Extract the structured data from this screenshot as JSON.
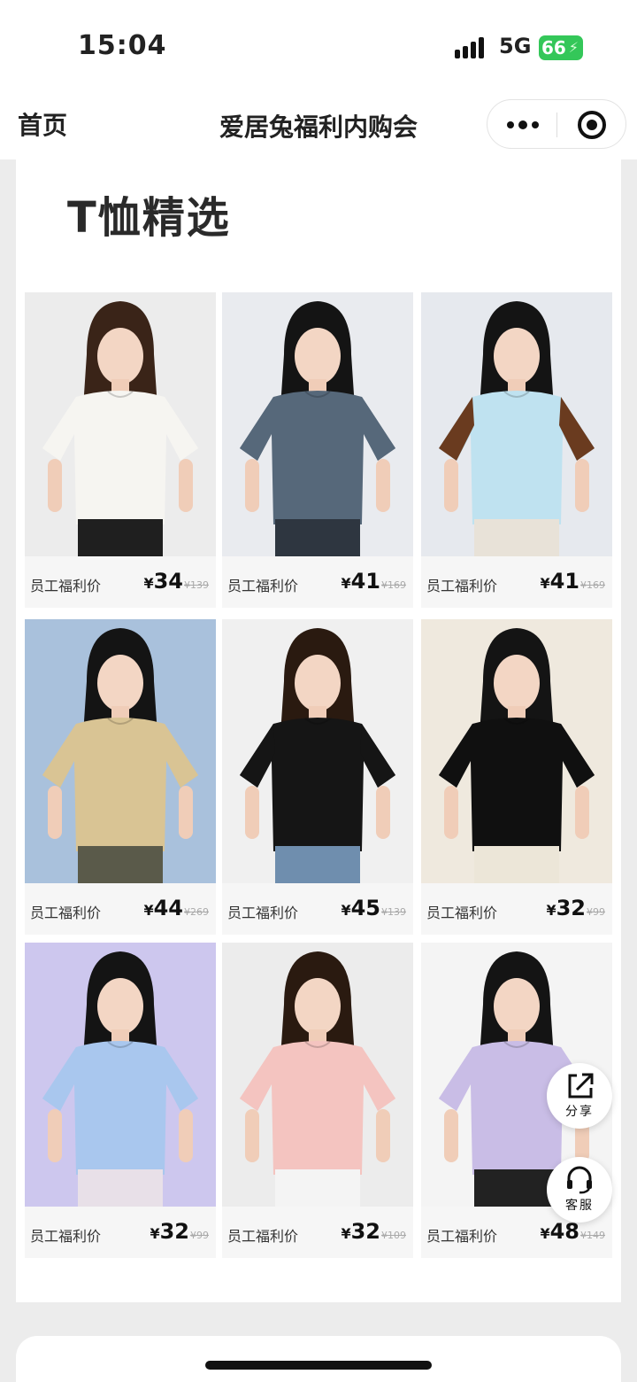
{
  "status_bar": {
    "time": "15:04",
    "network": "5G",
    "battery": "66"
  },
  "nav": {
    "home_label": "首页",
    "title": "爱居兔福利内购会"
  },
  "section": {
    "title": "T恤精选"
  },
  "price_label": "员工福利价",
  "currency": "¥",
  "products": [
    {
      "price": "34",
      "original": "139",
      "shirt": "#f6f5f1",
      "bg": "#ececec",
      "hair": "#3a2418",
      "pants": "#1f1f1f",
      "shirt_icon": "white-asymmetric-shirt-icon"
    },
    {
      "price": "41",
      "original": "169",
      "shirt": "#56687a",
      "bg": "#e9ebef",
      "hair": "#141414",
      "pants": "#2e3640",
      "shirt_icon": "denim-tee-icon"
    },
    {
      "price": "41",
      "original": "169",
      "shirt": "#bfe2f0",
      "bg": "#e6e9ee",
      "hair": "#141414",
      "pants": "#e8e2d8",
      "sleeve": "#6a3b1f",
      "shirt_icon": "raglan-tee-icon"
    },
    {
      "price": "44",
      "original": "269",
      "shirt": "#d9c494",
      "bg": "#a9c1dc",
      "hair": "#141414",
      "pants": "#5a5a4a",
      "shirt_icon": "graphic-tee-icon"
    },
    {
      "price": "45",
      "original": "139",
      "shirt": "#151515",
      "bg": "#f0f0f0",
      "hair": "#2a1a10",
      "pants": "#6f8eae",
      "shirt_icon": "black-tee-icon"
    },
    {
      "price": "32",
      "original": "99",
      "shirt": "#101010",
      "bg": "#efe9de",
      "hair": "#141414",
      "pants": "#ece6d8",
      "shirt_icon": "black-tee-scarf-icon"
    },
    {
      "price": "32",
      "original": "99",
      "shirt": "#a9c7ee",
      "bg": "#cdc7ee",
      "hair": "#141414",
      "pants": "#e8e0e8",
      "shirt_icon": "blue-tee-icon"
    },
    {
      "price": "32",
      "original": "109",
      "shirt": "#f4c4c0",
      "bg": "#ececec",
      "hair": "#2a1a10",
      "pants": "#f4f4f4",
      "shirt_icon": "pink-tee-icon"
    },
    {
      "price": "48",
      "original": "149",
      "shirt": "#c9bde6",
      "bg": "#f4f4f4",
      "hair": "#141414",
      "pants": "#222222",
      "shirt_icon": "lavender-tee-icon"
    }
  ],
  "float_buttons": {
    "share": "分享",
    "service": "客服"
  }
}
